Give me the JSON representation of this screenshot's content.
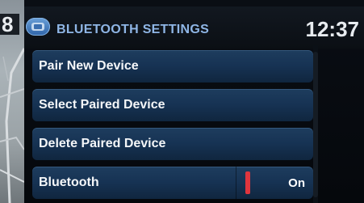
{
  "status": {
    "left_digit": "8",
    "clock": "12:37"
  },
  "header": {
    "icon": "bluetooth-phone-icon",
    "title": "BLUETOOTH SETTINGS"
  },
  "menu": {
    "items": [
      {
        "label": "Pair New Device"
      },
      {
        "label": "Select Paired Device"
      },
      {
        "label": "Delete Paired Device"
      },
      {
        "label": "Bluetooth",
        "toggle_value": "On"
      }
    ]
  },
  "colors": {
    "title_text": "#8fb6e6",
    "item_background": "#163253",
    "toggle_indicator": "#e0353d",
    "text": "#f4f6f8"
  }
}
